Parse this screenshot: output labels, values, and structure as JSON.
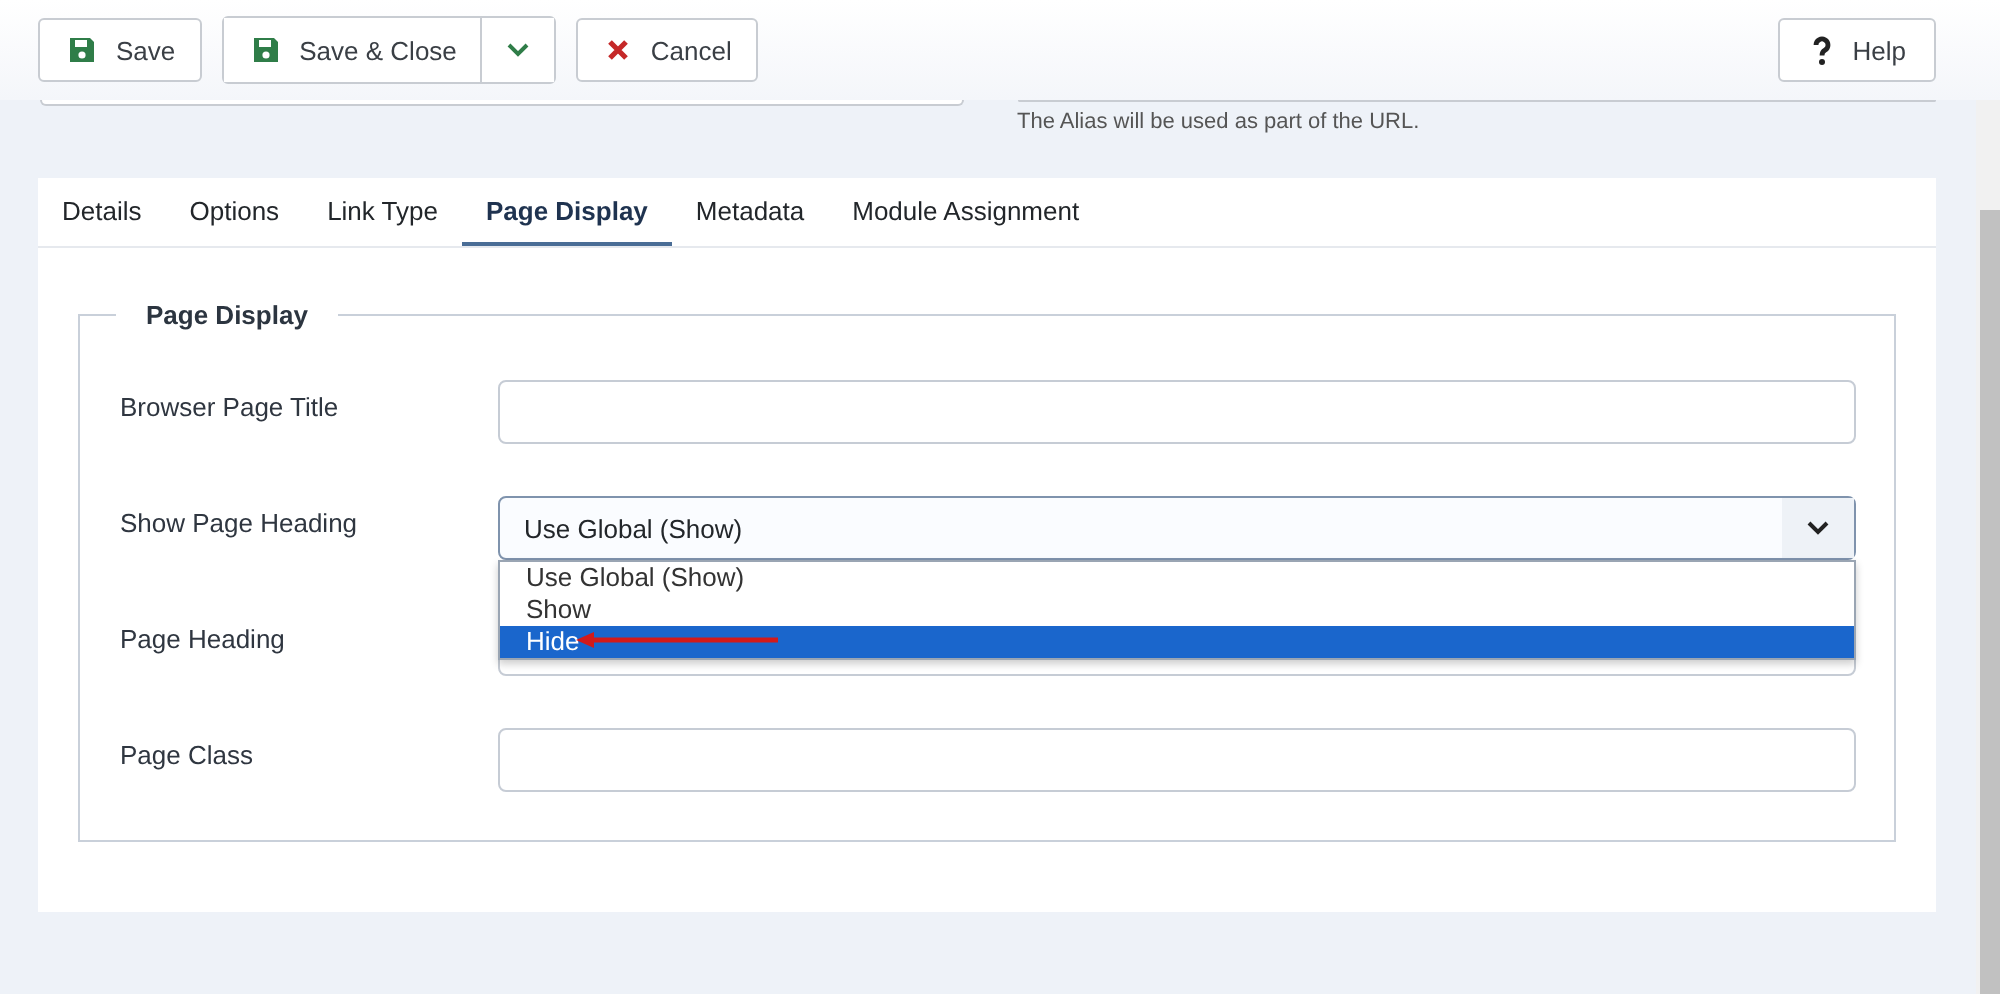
{
  "toolbar": {
    "buttons": [
      {
        "kind": "save",
        "label": "Save"
      },
      {
        "kind": "save-close",
        "label": "Save & Close"
      },
      {
        "kind": "cancel",
        "label": "Cancel"
      }
    ],
    "help": {
      "label": "Help"
    }
  },
  "alias_hint": "The Alias will be used as part of the URL.",
  "tabs": [
    {
      "label": "Details",
      "selected": false
    },
    {
      "label": "Options",
      "selected": false
    },
    {
      "label": "Link Type",
      "selected": false
    },
    {
      "label": "Page Display",
      "selected": true
    },
    {
      "label": "Metadata",
      "selected": false
    },
    {
      "label": "Module Assignment",
      "selected": false
    }
  ],
  "fieldset": {
    "legend": "Page Display",
    "fields": [
      {
        "label": "Browser Page Title",
        "kind": "text"
      },
      {
        "label": "Show Page Heading",
        "kind": "select",
        "value": "Use Global (Show)",
        "expanded": true,
        "options": [
          {
            "label": "Use Global (Show)",
            "highlighted": false
          },
          {
            "label": "Show",
            "highlighted": false
          },
          {
            "label": "Hide",
            "highlighted": true
          }
        ]
      },
      {
        "label": "Page Heading",
        "kind": "text"
      },
      {
        "label": "Page Class",
        "kind": "text"
      }
    ]
  }
}
